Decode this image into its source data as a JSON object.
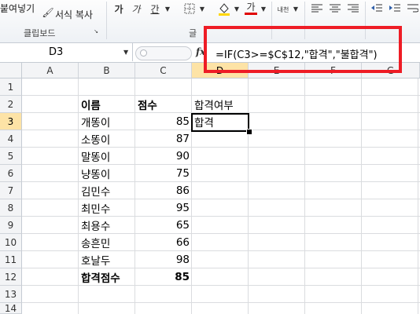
{
  "ribbon": {
    "paste_label": "붙여넣기",
    "format_painter_label": "서식 복사",
    "clipboard_group": "클립보드",
    "font_group_partial": "글"
  },
  "namebox": {
    "value": "D3"
  },
  "formula_bar": {
    "fx": "fx",
    "formula": "=IF(C3>=$C$12,\"합격\",\"불합격\")"
  },
  "columns": [
    "A",
    "B",
    "C",
    "D",
    "E",
    "F",
    "G"
  ],
  "active_column": "D",
  "rows": [
    "1",
    "2",
    "3",
    "4",
    "5",
    "6",
    "7",
    "8",
    "9",
    "10",
    "11",
    "12",
    "13",
    "14"
  ],
  "active_row": "3",
  "sheet": {
    "headers": {
      "name": "이름",
      "score": "점수",
      "pass_status": "합격여부"
    },
    "records": [
      {
        "name": "개똥이",
        "score": "85",
        "result": "합격"
      },
      {
        "name": "소똥이",
        "score": "87",
        "result": ""
      },
      {
        "name": "말똥이",
        "score": "90",
        "result": ""
      },
      {
        "name": "냥똥이",
        "score": "75",
        "result": ""
      },
      {
        "name": "김민수",
        "score": "86",
        "result": ""
      },
      {
        "name": "최민수",
        "score": "95",
        "result": ""
      },
      {
        "name": "최용수",
        "score": "65",
        "result": ""
      },
      {
        "name": "송흔민",
        "score": "66",
        "result": ""
      },
      {
        "name": "호날두",
        "score": "98",
        "result": ""
      }
    ],
    "threshold_label": "합격점수",
    "threshold_value": "85"
  },
  "colors": {
    "highlight_box": "#ee1c25",
    "active_header": "#fde3a6"
  }
}
